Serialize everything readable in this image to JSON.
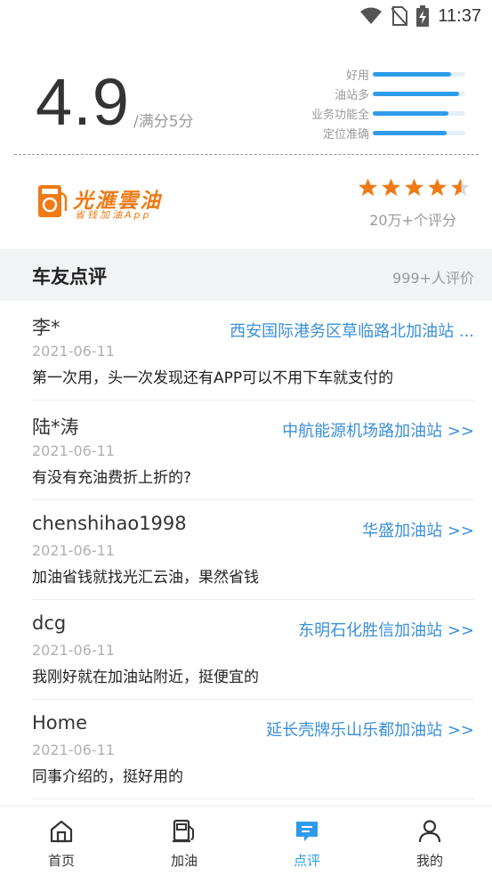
{
  "status_bar": {
    "time": "11:37"
  },
  "rating": {
    "score": "4.9",
    "max": "/满分5分",
    "bars": [
      {
        "label": "好用",
        "level": 0.85
      },
      {
        "label": "油站多",
        "level": 0.93
      },
      {
        "label": "业务功能全",
        "level": 0.82
      },
      {
        "label": "定位准确",
        "level": 0.8
      }
    ]
  },
  "brand": {
    "name": "光滙雲油",
    "slogan": "省钱加油App",
    "stars": 4.5,
    "rating_count": "20万+个评分",
    "colors": {
      "orange": "#f07a13",
      "star": "#f07a13"
    }
  },
  "section": {
    "title": "车友点评",
    "count": "999+人评价"
  },
  "reviews": [
    {
      "name": "李*",
      "station": "西安国际港务区草临路北加油站 ...",
      "date": "2021-06-11",
      "text": "第一次用，头一次发现还有APP可以不用下车就支付的"
    },
    {
      "name": "陆*涛",
      "station": "中航能源机场路加油站 >>",
      "date": "2021-06-11",
      "text": "有没有充油费折上折的?"
    },
    {
      "name": "chenshihao1998",
      "station": "华盛加油站 >>",
      "date": "2021-06-11",
      "text": "加油省钱就找光汇云油，果然省钱"
    },
    {
      "name": "dcg",
      "station": "东明石化胜信加油站 >>",
      "date": "2021-06-11",
      "text": "我刚好就在加油站附近，挺便宜的"
    },
    {
      "name": "Home",
      "station": "延长壳牌乐山乐都加油站 >>",
      "date": "2021-06-11",
      "text": "同事介绍的，挺好用的"
    }
  ],
  "tabs": [
    {
      "label": "首页",
      "icon": "home-icon"
    },
    {
      "label": "加油",
      "icon": "fuel-pump-icon"
    },
    {
      "label": "点评",
      "icon": "comment-icon",
      "active": true
    },
    {
      "label": "我的",
      "icon": "person-icon"
    }
  ],
  "colors": {
    "accent": "#2f9ceb",
    "link": "#3a8fd9"
  }
}
